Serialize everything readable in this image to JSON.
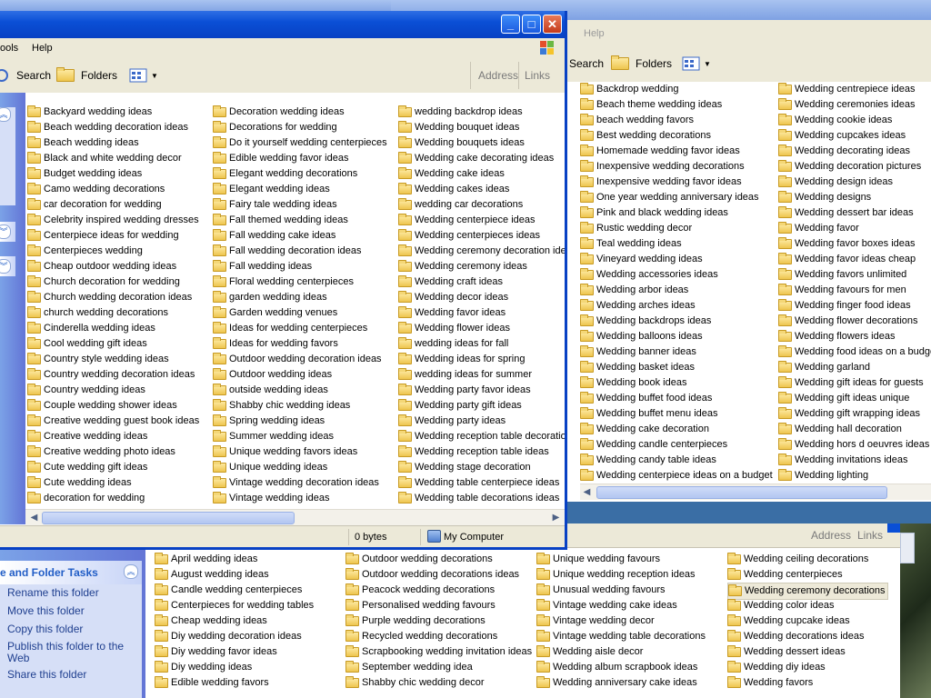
{
  "win1": {
    "menu": {
      "tools": "ools",
      "help": "Help"
    },
    "toolbar": {
      "search": "Search",
      "folders": "Folders",
      "address": "Address",
      "links": "Links"
    },
    "status": {
      "size": "0 bytes",
      "location": "My Computer"
    },
    "col1": [
      "Backyard wedding ideas",
      "Beach wedding decoration ideas",
      "Beach wedding ideas",
      "Black and white wedding decor",
      "Budget wedding ideas",
      "Camo wedding decorations",
      "car decoration for wedding",
      "Celebrity inspired wedding dresses",
      "Centerpiece ideas for wedding",
      "Centerpieces wedding",
      "Cheap outdoor wedding ideas",
      "Church decoration for wedding",
      "Church wedding decoration ideas",
      "church wedding decorations",
      "Cinderella wedding ideas",
      "Cool wedding gift ideas",
      "Country style wedding ideas",
      "Country wedding decoration ideas",
      "Country wedding ideas",
      "Couple wedding shower ideas",
      "Creative wedding guest book ideas",
      "Creative wedding ideas",
      "Creative wedding photo ideas",
      "Cute wedding gift ideas",
      "Cute wedding ideas",
      "decoration for wedding"
    ],
    "col2": [
      "Decoration wedding ideas",
      "Decorations for wedding",
      "Do it yourself wedding centerpieces",
      "Edible wedding favor ideas",
      "Elegant wedding decorations",
      "Elegant wedding ideas",
      "Fairy tale wedding ideas",
      "Fall themed wedding ideas",
      "Fall wedding cake ideas",
      "Fall wedding decoration ideas",
      "Fall wedding ideas",
      "Floral wedding centerpieces",
      "garden wedding ideas",
      "Garden wedding venues",
      "Ideas for wedding centerpieces",
      "Ideas for wedding favors",
      "Outdoor wedding decoration ideas",
      "Outdoor wedding ideas",
      "outside wedding ideas",
      "Shabby chic wedding ideas",
      "Spring wedding ideas",
      "Summer wedding ideas",
      "Unique wedding favors ideas",
      "Unique wedding ideas",
      "Vintage wedding decoration ideas",
      "Vintage wedding ideas"
    ],
    "col3": [
      "wedding backdrop ideas",
      "Wedding bouquet ideas",
      "Wedding bouquets ideas",
      "Wedding cake decorating ideas",
      "Wedding cake ideas",
      "Wedding cakes ideas",
      "wedding car decorations",
      "Wedding centerpiece ideas",
      "Wedding centerpieces ideas",
      "Wedding ceremony decoration ideas",
      "Wedding ceremony ideas",
      "Wedding craft ideas",
      "Wedding decor ideas",
      "Wedding favor ideas",
      "Wedding flower ideas",
      "wedding ideas for fall",
      "Wedding ideas for spring",
      "wedding ideas for summer",
      "Wedding party favor ideas",
      "Wedding party gift ideas",
      "Wedding party ideas",
      "Wedding reception table decorations",
      "Wedding reception table ideas",
      "Wedding stage decoration",
      "Wedding table centerpiece ideas",
      "Wedding table decorations ideas"
    ]
  },
  "win2": {
    "menu": {
      "help": "Help"
    },
    "toolbar": {
      "search": "Search",
      "folders": "Folders"
    },
    "col1": [
      "Backdrop wedding",
      "Beach theme wedding ideas",
      "beach wedding favors",
      "Best wedding decorations",
      "Homemade wedding favor ideas",
      "Inexpensive wedding decorations",
      "Inexpensive wedding favor ideas",
      "One year wedding anniversary ideas",
      "Pink and black wedding ideas",
      "Rustic wedding decor",
      "Teal wedding ideas",
      "Vineyard wedding ideas",
      "Wedding accessories ideas",
      "Wedding arbor ideas",
      "Wedding arches ideas",
      "Wedding backdrops ideas",
      "Wedding balloons ideas",
      "Wedding banner ideas",
      "Wedding basket ideas",
      "Wedding book ideas",
      "Wedding buffet food ideas",
      "Wedding buffet menu ideas",
      "Wedding cake decoration",
      "Wedding candle centerpieces",
      "Wedding candy table ideas",
      "Wedding centerpiece ideas on a budget"
    ],
    "col2": [
      "Wedding centrepiece ideas",
      "Wedding ceremonies ideas",
      "Wedding cookie ideas",
      "Wedding cupcakes ideas",
      "Wedding decorating ideas",
      "Wedding decoration pictures",
      "Wedding design ideas",
      "Wedding designs",
      "Wedding dessert bar ideas",
      "Wedding favor",
      "Wedding favor boxes ideas",
      "Wedding favor ideas cheap",
      "Wedding favors unlimited",
      "Wedding favours for men",
      "Wedding finger food ideas",
      "Wedding flower decorations",
      "Wedding flowers ideas",
      "Wedding food ideas on a budget",
      "Wedding garland",
      "Wedding gift ideas for guests",
      "Wedding gift ideas unique",
      "Wedding gift wrapping ideas",
      "Wedding hall decoration",
      "Wedding hors d oeuvres ideas",
      "Wedding invitations ideas",
      "Wedding lighting"
    ]
  },
  "win3": {
    "toolbar": {
      "address": "Address",
      "links": "Links"
    },
    "tasks": {
      "header": "e and Folder Tasks",
      "items": [
        "Rename this folder",
        "Move this folder",
        "Copy this folder",
        "Publish this folder to the Web",
        "Share this folder"
      ]
    },
    "col1": [
      "April wedding ideas",
      "August wedding ideas",
      "Candle wedding centerpieces",
      "Centerpieces for wedding tables",
      "Cheap wedding ideas",
      "Diy wedding decoration ideas",
      "Diy wedding favor ideas",
      "Diy wedding ideas",
      "Edible wedding favors"
    ],
    "col2": [
      "Outdoor wedding decorations",
      "Outdoor wedding decorations ideas",
      "Peacock wedding decorations",
      "Personalised wedding favours",
      "Purple wedding decorations",
      "Recycled wedding decorations",
      "Scrapbooking wedding invitation ideas",
      "September wedding idea",
      "Shabby chic wedding decor"
    ],
    "col3": [
      "Unique wedding favours",
      "Unique wedding reception ideas",
      "Unusual wedding favours",
      "Vintage wedding cake ideas",
      "Vintage wedding decor",
      "Vintage wedding table decorations",
      "Wedding aisle decor",
      "Wedding album scrapbook ideas",
      "Wedding anniversary cake ideas"
    ],
    "col4": [
      "Wedding ceiling decorations",
      "Wedding centerpieces",
      "Wedding ceremony decorations",
      "Wedding color ideas",
      "Wedding cupcake ideas",
      "Wedding decorations ideas",
      "Wedding dessert ideas",
      "Wedding diy ideas",
      "Wedding favors"
    ]
  }
}
